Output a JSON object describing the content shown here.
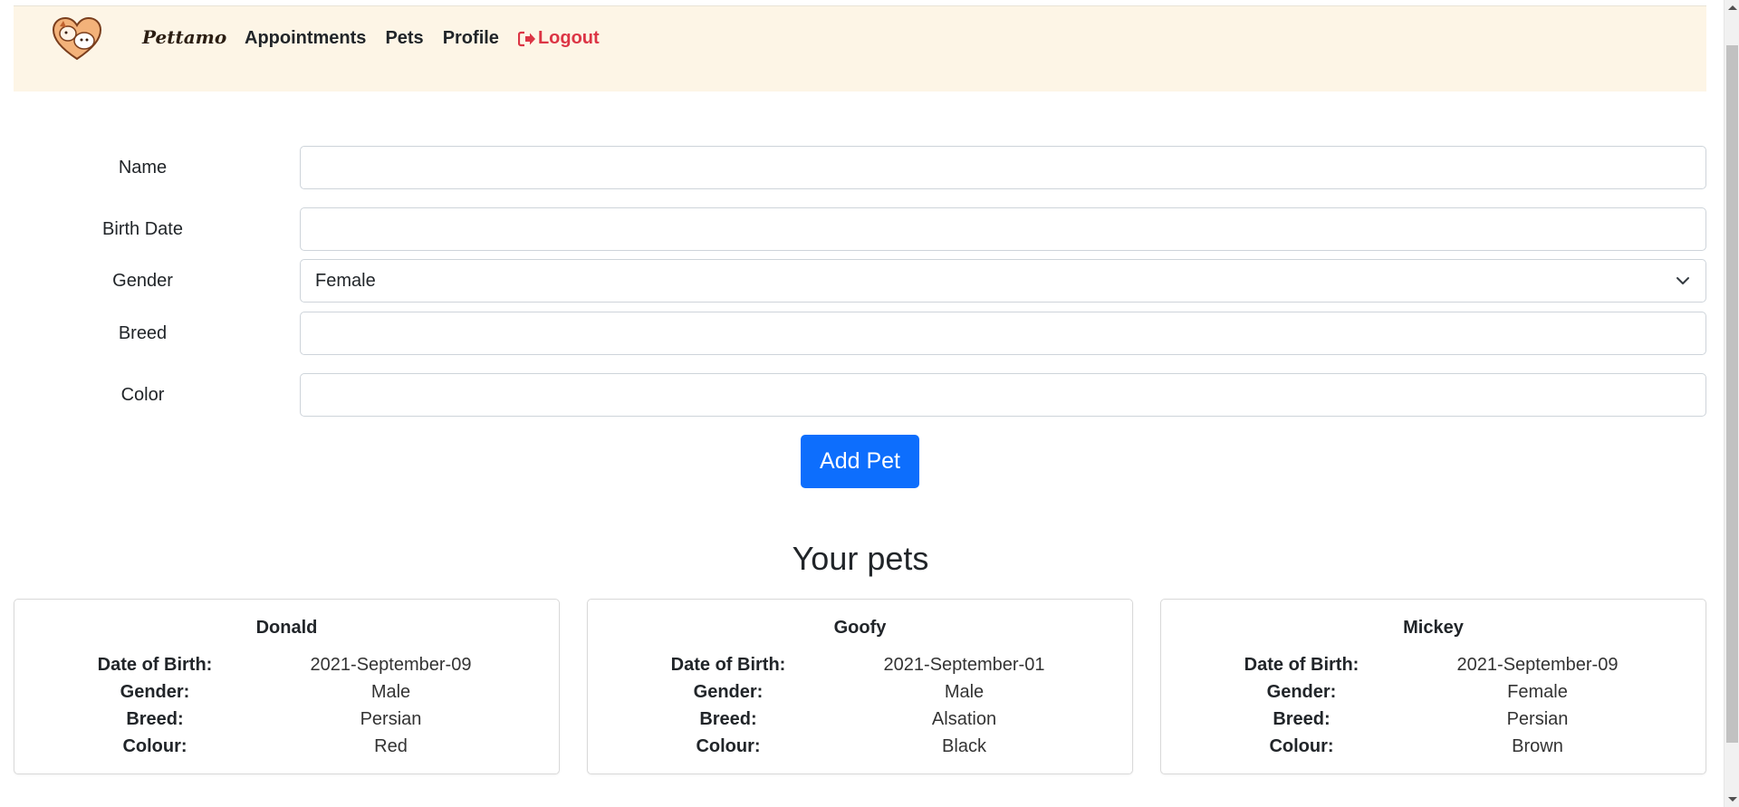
{
  "nav": {
    "logo_icon": "pet-heart-logo-icon",
    "brand": "Pettamo",
    "links": [
      {
        "label": "Appointments"
      },
      {
        "label": "Pets"
      },
      {
        "label": "Profile"
      },
      {
        "label": "Logout",
        "icon": "logout-icon"
      }
    ]
  },
  "form": {
    "name": {
      "label": "Name",
      "value": ""
    },
    "birth_date": {
      "label": "Birth Date",
      "value": ""
    },
    "gender": {
      "label": "Gender",
      "value": "Female",
      "icon": "chevron-down-icon"
    },
    "breed": {
      "label": "Breed",
      "value": ""
    },
    "color": {
      "label": "Color",
      "value": ""
    },
    "submit_label": "Add Pet"
  },
  "pets_section": {
    "title": "Your pets",
    "field_labels": {
      "dob": "Date of Birth:",
      "gender": "Gender:",
      "breed": "Breed:",
      "colour": "Colour:"
    },
    "pets": [
      {
        "name": "Donald",
        "dob": "2021-September-09",
        "gender": "Male",
        "breed": "Persian",
        "colour": "Red"
      },
      {
        "name": "Goofy",
        "dob": "2021-September-01",
        "gender": "Male",
        "breed": "Alsation",
        "colour": "Black"
      },
      {
        "name": "Mickey",
        "dob": "2021-September-09",
        "gender": "Female",
        "breed": "Persian",
        "colour": "Brown"
      }
    ]
  },
  "colors": {
    "navbar_bg": "#fdf5e6",
    "primary": "#0d6efd",
    "logout": "#dc3545"
  }
}
